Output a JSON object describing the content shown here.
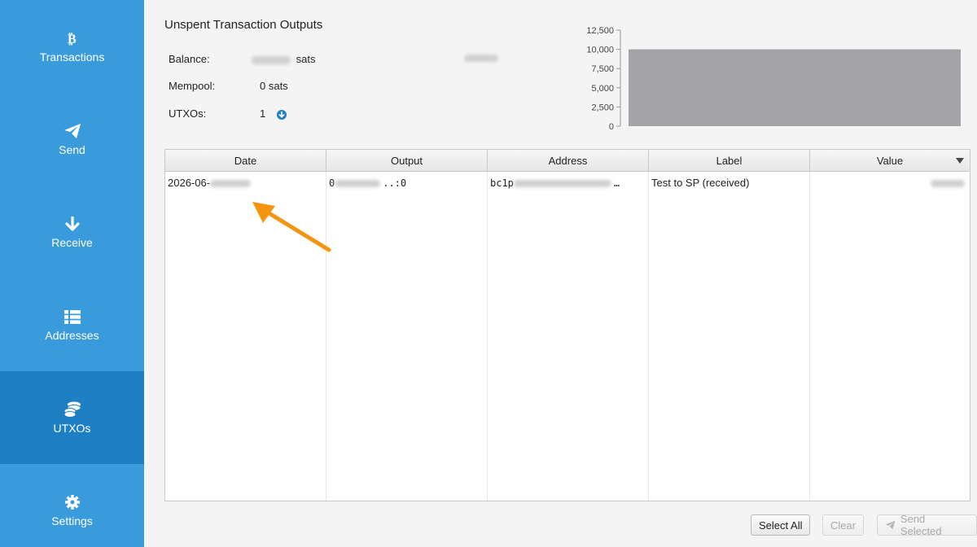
{
  "nav": {
    "items": [
      {
        "label": "Transactions",
        "icon": "bitcoin-icon",
        "active": false
      },
      {
        "label": "Send",
        "icon": "paper-plane-icon",
        "active": false
      },
      {
        "label": "Receive",
        "icon": "arrow-down-icon",
        "active": false
      },
      {
        "label": "Addresses",
        "icon": "list-icon",
        "active": false
      },
      {
        "label": "UTXOs",
        "icon": "coins-icon",
        "active": true
      },
      {
        "label": "Settings",
        "icon": "gear-icon",
        "active": false
      }
    ]
  },
  "summary": {
    "title": "Unspent Transaction Outputs",
    "balance_label": "Balance:",
    "balance_unit": "sats",
    "mempool_label": "Mempool:",
    "mempool_value": "0 sats",
    "utxos_label": "UTXOs:",
    "utxos_value": "1"
  },
  "chart_data": {
    "type": "bar",
    "categories": [
      ""
    ],
    "values": [
      10000
    ],
    "yticks": [
      "12,500",
      "10,000",
      "7,500",
      "5,000",
      "2,500",
      "0"
    ],
    "ylim": [
      0,
      12500
    ],
    "grid": false,
    "bar_color": "#a3a3a8"
  },
  "table": {
    "headers": [
      "Date",
      "Output",
      "Address",
      "Label",
      "Value"
    ],
    "rows": [
      {
        "date": "2026-06-",
        "output_prefix": "0",
        "output_suffix": "..:0",
        "address_prefix": "bc1p",
        "address_suffix": "…",
        "label": "Test to SP (received)"
      }
    ]
  },
  "buttons": {
    "select_all": "Select All",
    "clear": "Clear",
    "send_selected": "Send Selected"
  },
  "colors": {
    "sidebar": "#3a9bdc",
    "sidebar_active": "#1f7fc3",
    "annotation_arrow": "#f5940f"
  }
}
